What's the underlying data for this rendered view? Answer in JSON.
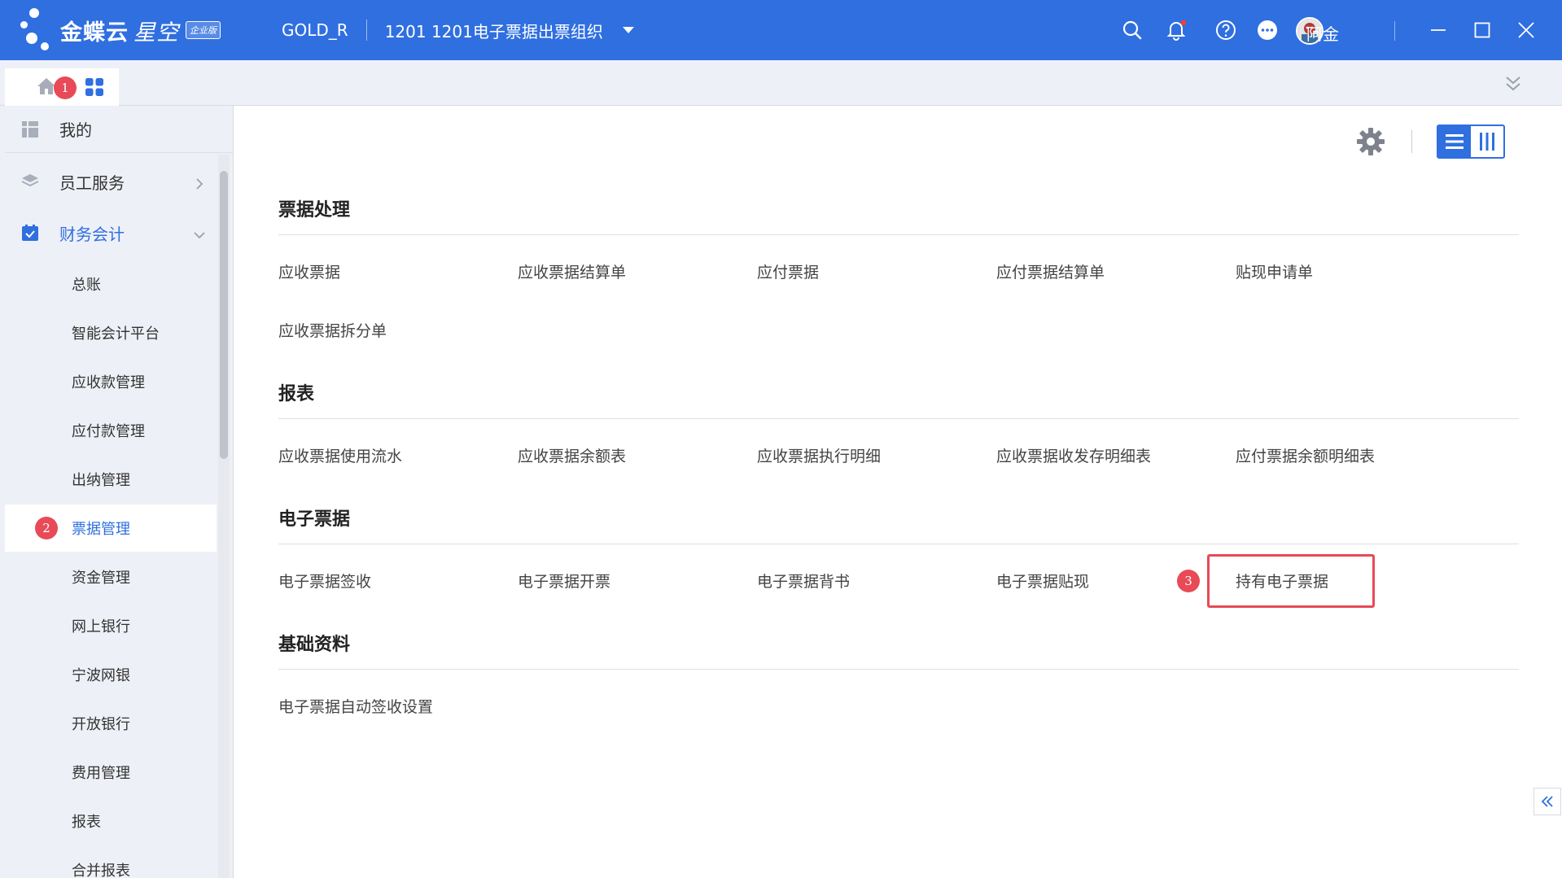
{
  "titlebar": {
    "logo_main": "金蝶云",
    "logo_sub": "星空",
    "logo_badge": "企业版",
    "user": "GOLD_R",
    "org": "1201  1201电子票据出票组织",
    "user_name": "阿金"
  },
  "tabs": {
    "home_badge": "1"
  },
  "sidebar": {
    "top_label": "我的",
    "level1": [
      {
        "label": "员工服务"
      },
      {
        "label": "财务会计"
      }
    ],
    "level2": [
      {
        "label": "总账"
      },
      {
        "label": "智能会计平台"
      },
      {
        "label": "应收款管理"
      },
      {
        "label": "应付款管理"
      },
      {
        "label": "出纳管理"
      },
      {
        "label": "票据管理",
        "badge": "2"
      },
      {
        "label": "资金管理"
      },
      {
        "label": "网上银行"
      },
      {
        "label": "宁波网银"
      },
      {
        "label": "开放银行"
      },
      {
        "label": "费用管理"
      },
      {
        "label": "报表"
      },
      {
        "label": "合并报表"
      }
    ]
  },
  "main": {
    "sections": [
      {
        "title": "票据处理",
        "links": [
          "应收票据",
          "应收票据结算单",
          "应付票据",
          "应付票据结算单",
          "贴现申请单",
          "应收票据拆分单"
        ]
      },
      {
        "title": "报表",
        "links": [
          "应收票据使用流水",
          "应收票据余额表",
          "应收票据执行明细",
          "应收票据收发存明细表",
          "应付票据余额明细表"
        ]
      },
      {
        "title": "电子票据",
        "links": [
          "电子票据签收",
          "电子票据开票",
          "电子票据背书",
          "电子票据贴现",
          "持有电子票据"
        ],
        "badge": "3"
      },
      {
        "title": "基础资料",
        "links": [
          "电子票据自动签收设置"
        ]
      }
    ]
  },
  "colors": {
    "brand": "#2f6fe0",
    "badge": "#e84a57"
  }
}
